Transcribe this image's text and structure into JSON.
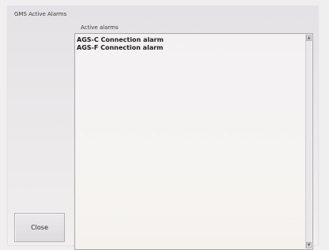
{
  "window": {
    "title": "GMS Active Alarms"
  },
  "alarms": {
    "label": "Active alarms",
    "items": [
      "AGS-C Connection alarm",
      "AGS-F Connection alarm"
    ]
  },
  "scrollbar": {
    "up_glyph": "▲",
    "down_glyph": "▼"
  },
  "actions": {
    "close_label": "Close"
  },
  "icons": {
    "scroll_up": "arrow-up-icon",
    "scroll_down": "arrow-down-icon"
  }
}
